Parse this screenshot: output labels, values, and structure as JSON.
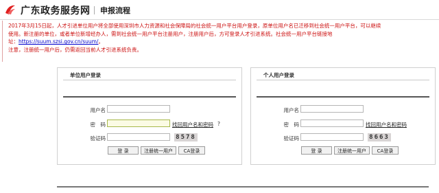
{
  "header": {
    "site_name": "广东政务服务网",
    "page_title": "申报流程"
  },
  "notice": {
    "line1": "2017年3月15日起，人才引进单位用户将全部使用深圳市人力资源和社会保障局的社会统一用户平台用户登录，原单位用户名已迁移到社会统一用户平台，可以继续",
    "line2": "使用。新注册的单位，或者单位新增经办人，需到社会统一用户平台注册用户，注册用户后，方可登录人才引进系统。社会统一用户平台链接地",
    "line3_prefix": "址：",
    "url": "https://suum.szsi.gov.cn/suum/",
    "line3_suffix": "。",
    "line4": "注意，注册统一用户后，仍需返回当前人才引进系统负责。"
  },
  "unit_login": {
    "title": "单位用户登录",
    "username_label": "用户名",
    "password_label": "密　码",
    "captcha_label": "验证码",
    "forgot_link": "找回用户名和密码",
    "forgot_suffix": "?",
    "captcha_text": "8578",
    "login_button": "登 录",
    "register_button": "注册统一用户",
    "ca_button": "CA登录"
  },
  "personal_login": {
    "title": "个人用户登录",
    "username_label": "用户名",
    "password_label": "密　码",
    "captcha_label": "验证码",
    "forgot_link": "找回用户名和密码",
    "captcha_text": "8663",
    "login_button": "登 录",
    "register_button": "注册统一用户",
    "ca_button": "CA登录"
  },
  "colors": {
    "notice_red": "#cc1111",
    "logo_red": "#e02020",
    "active_input_border": "#a7b84a"
  }
}
